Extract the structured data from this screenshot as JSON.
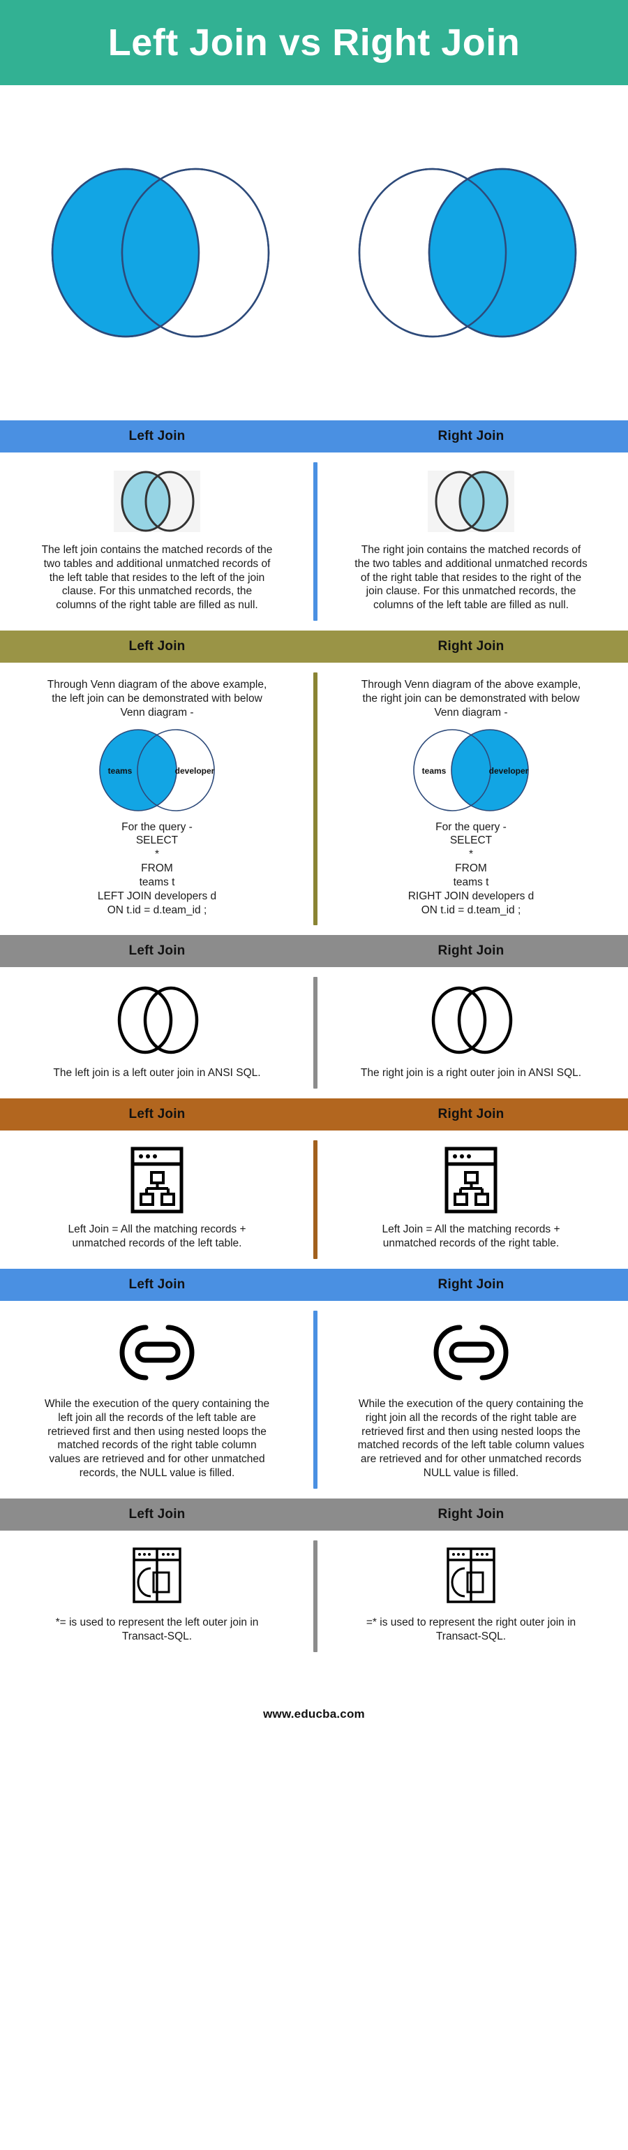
{
  "header": {
    "title": "Left Join vs Right Join",
    "background_color": "#32b193",
    "text_color": "#ffffff"
  },
  "hero": {
    "left_venn_name": "left-join-venn-filled-left",
    "right_venn_name": "right-join-venn-filled-right",
    "fill_color": "#12a5e4",
    "stroke_color": "#2d4a7a"
  },
  "colors": {
    "blue": "#4a90e2",
    "olive": "#9a9446",
    "gray": "#8c8c8c",
    "orange": "#b2661f",
    "venn_blue": "#12a5e4",
    "venn_light_blue": "#96d4e4",
    "black": "#111111"
  },
  "sections": [
    {
      "id": "definition",
      "bar_color": "#4a90e2",
      "divider_color": "#4a90e2",
      "icon": "venn-light-blue-icon",
      "left": {
        "heading": "Left Join",
        "text": "The left join contains the matched records of the two tables and additional unmatched records of the left table that resides to the left of the join clause. For this unmatched records, the columns of the right table are filled as null."
      },
      "right": {
        "heading": "Right Join",
        "text": "The right join contains the matched records of the two tables and additional unmatched records of the right table that resides to the right of the join clause. For this unmatched records, the columns of the left table are filled as null."
      }
    },
    {
      "id": "venn-example",
      "bar_color": "#9a9446",
      "divider_color": "#8a8433",
      "icon": "venn-labeled-icon",
      "venn_label_left": "teams",
      "venn_label_right": "developer",
      "left": {
        "heading": "Left Join",
        "intro": "Through Venn diagram of the above example, the left join can be demonstrated with below Venn diagram -",
        "query": "For the query -\nSELECT\n*\nFROM\nteams t\nLEFT JOIN developers d\nON t.id = d.team_id ;"
      },
      "right": {
        "heading": "Right Join",
        "intro": "Through Venn diagram of the above example, the right join can be demonstrated with below Venn diagram -",
        "query": "For the query -\nSELECT\n*\nFROM\nteams t\nRIGHT JOIN developers d\nON t.id = d.team_id ;"
      }
    },
    {
      "id": "ansi-sql",
      "bar_color": "#8c8c8c",
      "divider_color": "#8c8c8c",
      "icon": "venn-outline-icon",
      "left": {
        "heading": "Left Join",
        "text": "The left join is a left outer join in ANSI SQL."
      },
      "right": {
        "heading": "Right Join",
        "text": "The right join is a right outer join in ANSI SQL."
      }
    },
    {
      "id": "records-formula",
      "bar_color": "#b2661f",
      "divider_color": "#a2601d",
      "icon": "browser-sitemap-icon",
      "left": {
        "heading": "Left Join",
        "text": "Left Join = All the matching records + unmatched records of the left table."
      },
      "right": {
        "heading": "Right Join",
        "text": "Left Join = All the matching records + unmatched records of the right table."
      }
    },
    {
      "id": "execution",
      "bar_color": "#4a90e2",
      "divider_color": "#4a90e2",
      "icon": "chain-link-icon",
      "left": {
        "heading": "Left Join",
        "text": "While the execution of the query containing the left join all the records of the left table are retrieved first and then using nested loops the matched records of the right table column values are retrieved and for other unmatched records, the NULL value is filled."
      },
      "right": {
        "heading": "Right Join",
        "text": "While the execution of the query containing the right join all the records of the right table are retrieved first and then using nested loops the matched records of the left table column values are retrieved and for other unmatched records NULL value is filled."
      }
    },
    {
      "id": "transact-sql",
      "bar_color": "#8c8c8c",
      "divider_color": "#8c8c8c",
      "icon": "browser-split-panel-icon",
      "left": {
        "heading": "Left Join",
        "text": "*= is used to represent the left outer join in Transact-SQL."
      },
      "right": {
        "heading": "Right Join",
        "text": "=* is used to represent the right outer join in Transact-SQL."
      }
    }
  ],
  "footer": {
    "url": "www.educba.com"
  }
}
